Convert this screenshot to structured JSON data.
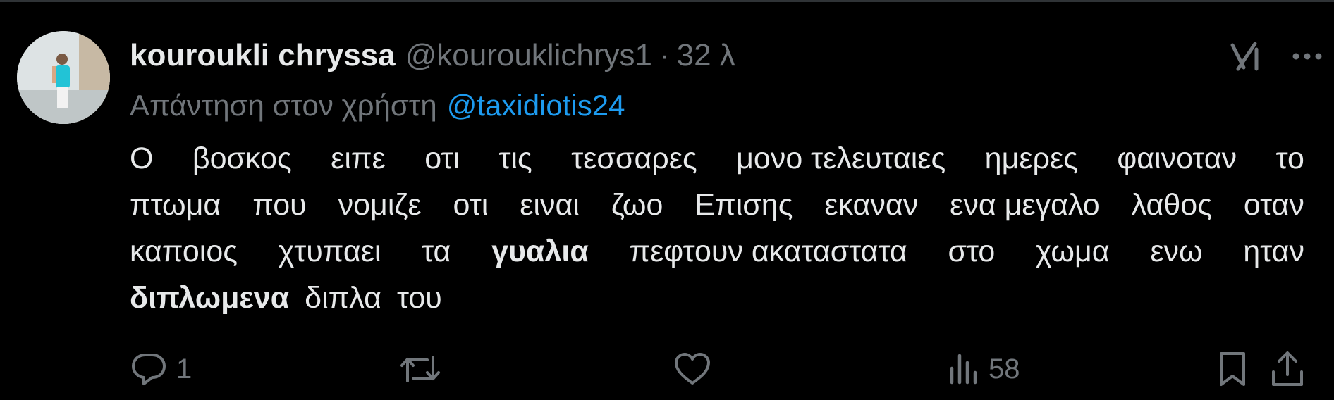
{
  "post": {
    "display_name": "kouroukli chryssa",
    "handle": "@kourouklichrys1",
    "separator": "·",
    "time": "32 λ",
    "reply_prefix": "Απάντηση στον χρήστη",
    "reply_to": "@taxidiotis24",
    "text_lines": [
      [
        "Ο",
        "βοσκος",
        "ειπε",
        "οτι",
        "τις",
        "τεσσαρες",
        "μονο τελευταιες",
        "ημερες",
        "φαινοταν",
        "το"
      ],
      [
        "πτωμα",
        "που",
        "νομιζε",
        "οτι",
        "ειναι",
        "ζωο",
        "Επισης",
        "εκαναν",
        "ενα μεγαλο",
        "λαθος",
        "οταν"
      ],
      [
        "καποιος",
        "χτυπαει",
        "τα",
        "γυαλια",
        "πεφτουν ακαταστατα",
        "στο",
        "χωμα",
        "ενω",
        "ηταν"
      ],
      [
        "διπλωμενα",
        "διπλα",
        "του"
      ]
    ],
    "bold_words": [
      "γυαλια",
      "διπλωμενα"
    ]
  },
  "actions": {
    "reply_count": "1",
    "repost_count": "",
    "like_count": "",
    "views_count": "58"
  },
  "icons": {
    "grok": "grok-icon",
    "more": "more-dots-icon",
    "reply": "reply-bubble-icon",
    "repost": "repost-icon",
    "like": "heart-icon",
    "views": "views-bar-icon",
    "bookmark": "bookmark-icon",
    "share": "share-upload-icon"
  },
  "colors": {
    "background": "#000000",
    "text": "#e7e9ea",
    "secondary": "#71767b",
    "link": "#1d9bf0",
    "avatar_shirt": "#22c3d6"
  }
}
